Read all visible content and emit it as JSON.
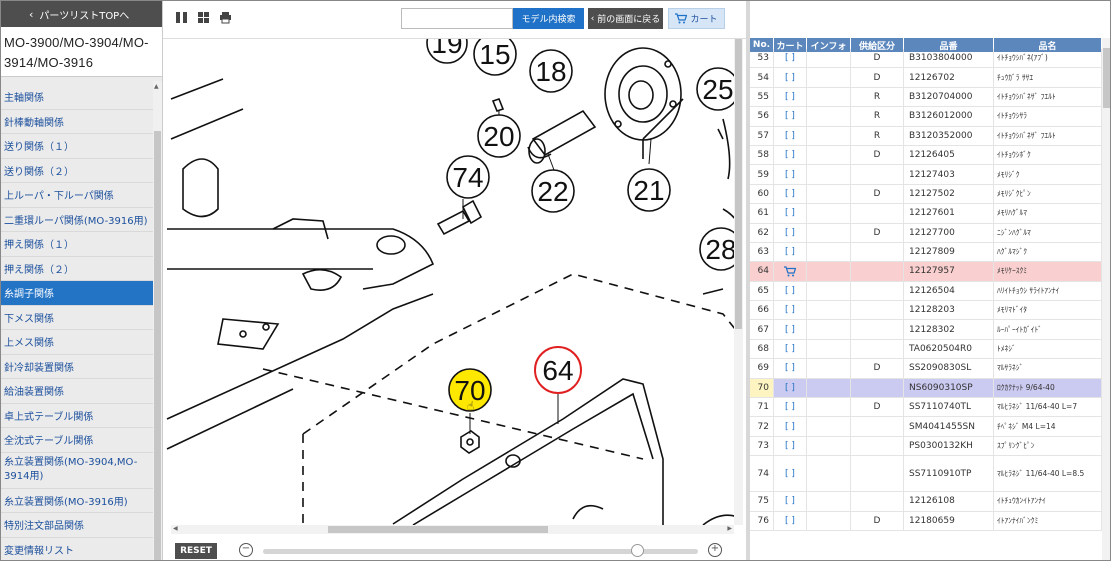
{
  "sidebar": {
    "top_link": "パーツリストTOPへ",
    "model_title": "MO-3900/MO-3904/MO-3914/MO-3916",
    "items": [
      {
        "label": "主軸関係"
      },
      {
        "label": "針棒動軸関係"
      },
      {
        "label": "送り関係（１）"
      },
      {
        "label": "送り関係（２）"
      },
      {
        "label": "上ルーパ・下ルーパ関係"
      },
      {
        "label": "二重環ルーパ関係(MO-3916用)"
      },
      {
        "label": "押え関係（１）"
      },
      {
        "label": "押え関係（２）"
      },
      {
        "label": "糸調子関係",
        "active": true
      },
      {
        "label": "下メス関係"
      },
      {
        "label": "上メス関係"
      },
      {
        "label": "針冷却装置関係"
      },
      {
        "label": "給油装置関係"
      },
      {
        "label": "卓上式テーブル関係"
      },
      {
        "label": "全沈式テーブル関係"
      },
      {
        "label": "糸立装置関係(MO-3904,MO-3914用)",
        "tall": true
      },
      {
        "label": "糸立装置関係(MO-3916用)"
      },
      {
        "label": "特別注文部品関係"
      },
      {
        "label": "変更情報リスト"
      }
    ]
  },
  "toolbar": {
    "search_placeholder": "",
    "search_button": "モデル内検索",
    "back_button": "前の画面に戻る",
    "cart_button": "カート"
  },
  "diagram": {
    "callouts": [
      {
        "label": "19"
      },
      {
        "label": "15"
      },
      {
        "label": "18"
      },
      {
        "label": "25"
      },
      {
        "label": "20"
      },
      {
        "label": "74"
      },
      {
        "label": "22"
      },
      {
        "label": "21"
      },
      {
        "label": "28"
      },
      {
        "label": "64",
        "state": "selected"
      },
      {
        "label": "70",
        "state": "hover"
      }
    ]
  },
  "zoom": {
    "reset_label": "RESET",
    "level": 0.86
  },
  "parts_table": {
    "headers": {
      "no": "No.",
      "cart": "カート",
      "info": "インフォ",
      "supply": "供給区分",
      "part_no": "品番",
      "name": "品名"
    },
    "rows": [
      {
        "no": "53",
        "cart": "[ ]",
        "supply": "D",
        "part_no": "B3103804000",
        "name": "ｲﾄﾁｮｳｼﾊﾞﾈ(ｱﾌﾞ)"
      },
      {
        "no": "54",
        "cart": "[ ]",
        "supply": "D",
        "part_no": "12126702",
        "name": "ﾁｭｳｶﾞﾗ ｻｻｴ"
      },
      {
        "no": "55",
        "cart": "[ ]",
        "supply": "R",
        "part_no": "B3120704000",
        "name": "ｲﾄﾁｮｳｼﾊﾞﾈｻﾞ ﾌｴﾙﾄ"
      },
      {
        "no": "56",
        "cart": "[ ]",
        "supply": "R",
        "part_no": "B3126012000",
        "name": "ｲﾄﾁｮｳｼｻﾗ"
      },
      {
        "no": "57",
        "cart": "[ ]",
        "supply": "R",
        "part_no": "B3120352000",
        "name": "ｲﾄﾁｮｳｼﾊﾞﾈｻﾞ ﾌｴﾙﾄ"
      },
      {
        "no": "58",
        "cart": "[ ]",
        "supply": "D",
        "part_no": "12126405",
        "name": "ｲﾄﾁｮｳｼﾎﾞｸ"
      },
      {
        "no": "59",
        "cart": "[ ]",
        "supply": "",
        "part_no": "12127403",
        "name": "ﾒﾓﾘｼﾞｸ"
      },
      {
        "no": "60",
        "cart": "[ ]",
        "supply": "D",
        "part_no": "12127502",
        "name": "ﾒﾓﾘｼﾞｸﾋﾟﾝ"
      },
      {
        "no": "61",
        "cart": "[ ]",
        "supply": "",
        "part_no": "12127601",
        "name": "ﾒﾓﾘﾊｸﾞﾙﾏ"
      },
      {
        "no": "62",
        "cart": "[ ]",
        "supply": "D",
        "part_no": "12127700",
        "name": "ﾆｼﾞﾝﾊｸﾞﾙﾏ"
      },
      {
        "no": "63",
        "cart": "[ ]",
        "supply": "",
        "part_no": "12127809",
        "name": "ﾊｸﾞﾙﾏｼﾞｸ"
      },
      {
        "no": "64",
        "cart": "cart",
        "supply": "",
        "part_no": "12127957",
        "name": "ﾒﾓﾘｹｰｽｸﾐ",
        "highlight": "red"
      },
      {
        "no": "65",
        "cart": "[ ]",
        "supply": "",
        "part_no": "12126504",
        "name": "ﾊﾘｲﾄﾁｮｳｼ ｻﾗｲﾄｱﾝﾅｲ"
      },
      {
        "no": "66",
        "cart": "[ ]",
        "supply": "",
        "part_no": "12128203",
        "name": "ﾒﾓﾘﾏﾄﾞｲﾀ"
      },
      {
        "no": "67",
        "cart": "[ ]",
        "supply": "",
        "part_no": "12128302",
        "name": "ﾙｰﾊﾟｰｲﾄｶﾞｲﾄﾞ"
      },
      {
        "no": "68",
        "cart": "[ ]",
        "supply": "",
        "part_no": "TA0620504R0",
        "name": "ﾄﾒﾈｼﾞ"
      },
      {
        "no": "69",
        "cart": "[ ]",
        "supply": "D",
        "part_no": "SS2090830SL",
        "name": "ﾏﾙｻﾗﾈｼﾞ"
      },
      {
        "no": "70",
        "cart": "[ ]",
        "supply": "",
        "part_no": "NS6090310SP",
        "name": "ﾛｸｶｸﾅｯﾄ 9/64-40",
        "highlight": "blue"
      },
      {
        "no": "71",
        "cart": "[ ]",
        "supply": "D",
        "part_no": "SS7110740TL",
        "name": "ﾏﾙﾋﾗﾈｼﾞ 11/64-40 L=7"
      },
      {
        "no": "72",
        "cart": "[ ]",
        "supply": "",
        "part_no": "SM4041455SN",
        "name": "ﾁﾍﾟﾈｼﾞ M4 L=14"
      },
      {
        "no": "73",
        "cart": "[ ]",
        "supply": "",
        "part_no": "PS0300132KH",
        "name": "ｽﾌﾟﾘﾝｸﾞﾋﾟﾝ"
      },
      {
        "no": "74",
        "cart": "[ ]",
        "supply": "",
        "part_no": "SS7110910TP",
        "name": "ﾏﾙﾋﾗﾈｼﾞ 11/64-40 L=8.5",
        "tall": true
      },
      {
        "no": "75",
        "cart": "[ ]",
        "supply": "",
        "part_no": "12126108",
        "name": "ｲﾄﾁｭｳｶﾝｲﾄｱﾝﾅｲ"
      },
      {
        "no": "76",
        "cart": "[ ]",
        "supply": "D",
        "part_no": "12180659",
        "name": "ｲﾄｱﾝﾅｲﾊﾞﾝｸﾐ"
      }
    ]
  },
  "colors": {
    "accent": "#1f72c7",
    "dark": "#4e4e4e",
    "row_red": "#f9cfcf",
    "row_blue": "#cbcaf0",
    "hover_callout": "#ffe800",
    "selected_ring": "#e02020"
  }
}
